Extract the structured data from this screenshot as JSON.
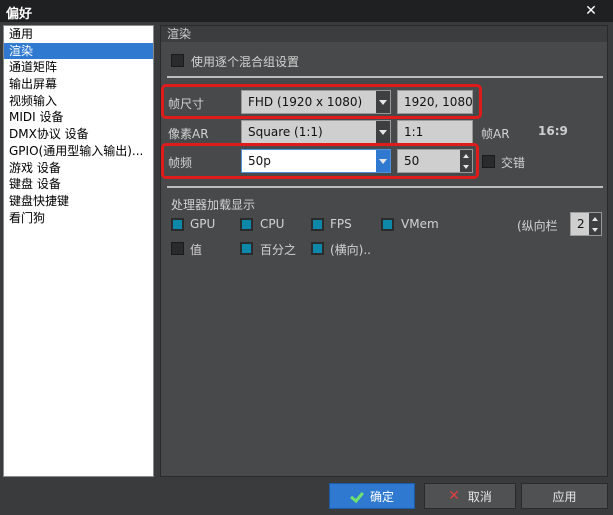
{
  "window": {
    "title": "偏好",
    "close_glyph": "✕"
  },
  "sidebar": {
    "items": [
      {
        "label": "通用"
      },
      {
        "label": "渲染"
      },
      {
        "label": "通道矩阵"
      },
      {
        "label": "输出屏幕"
      },
      {
        "label": "视频输入"
      },
      {
        "label": "MIDI 设备"
      },
      {
        "label": "DMX协议 设备"
      },
      {
        "label": "GPIO(通用型输入输出)..."
      },
      {
        "label": "游戏 设备"
      },
      {
        "label": "键盘 设备"
      },
      {
        "label": "键盘快捷键"
      },
      {
        "label": "看门狗"
      }
    ],
    "selected": "渲染"
  },
  "panel": {
    "title": "渲染",
    "mix_group_checkbox": {
      "label": "使用逐个混合组设置",
      "checked": false
    },
    "frame_size": {
      "label": "帧尺寸",
      "value": "FHD (1920 x 1080)",
      "field": "1920, 1080"
    },
    "pixel_ar": {
      "label": "像素AR",
      "value": "Square (1:1)",
      "field": "1:1",
      "frame_ar_label": "帧AR",
      "frame_ar_value": "16:9"
    },
    "frame_rate": {
      "label": "帧频",
      "value": "50p",
      "spin": "50",
      "interlace_label": "交错",
      "interlace_checked": false
    },
    "processor": {
      "title": "处理器加载显示",
      "items": [
        {
          "label": "GPU",
          "checked": true
        },
        {
          "label": "CPU",
          "checked": true
        },
        {
          "label": "FPS",
          "checked": true
        },
        {
          "label": "VMem",
          "checked": true
        },
        {
          "label": "值",
          "checked": false
        },
        {
          "label": "百分之",
          "checked": true
        },
        {
          "label": "(横向)..",
          "checked": true
        }
      ],
      "columns_label": "(纵向栏",
      "columns_value": "2"
    }
  },
  "footer": {
    "ok_label": "确定",
    "cancel_label": "取消",
    "apply_label": "应用"
  },
  "colors": {
    "accent": "#2f79d1",
    "checkbox_checked": "#0e88a8",
    "highlight": "#e01b1b"
  }
}
